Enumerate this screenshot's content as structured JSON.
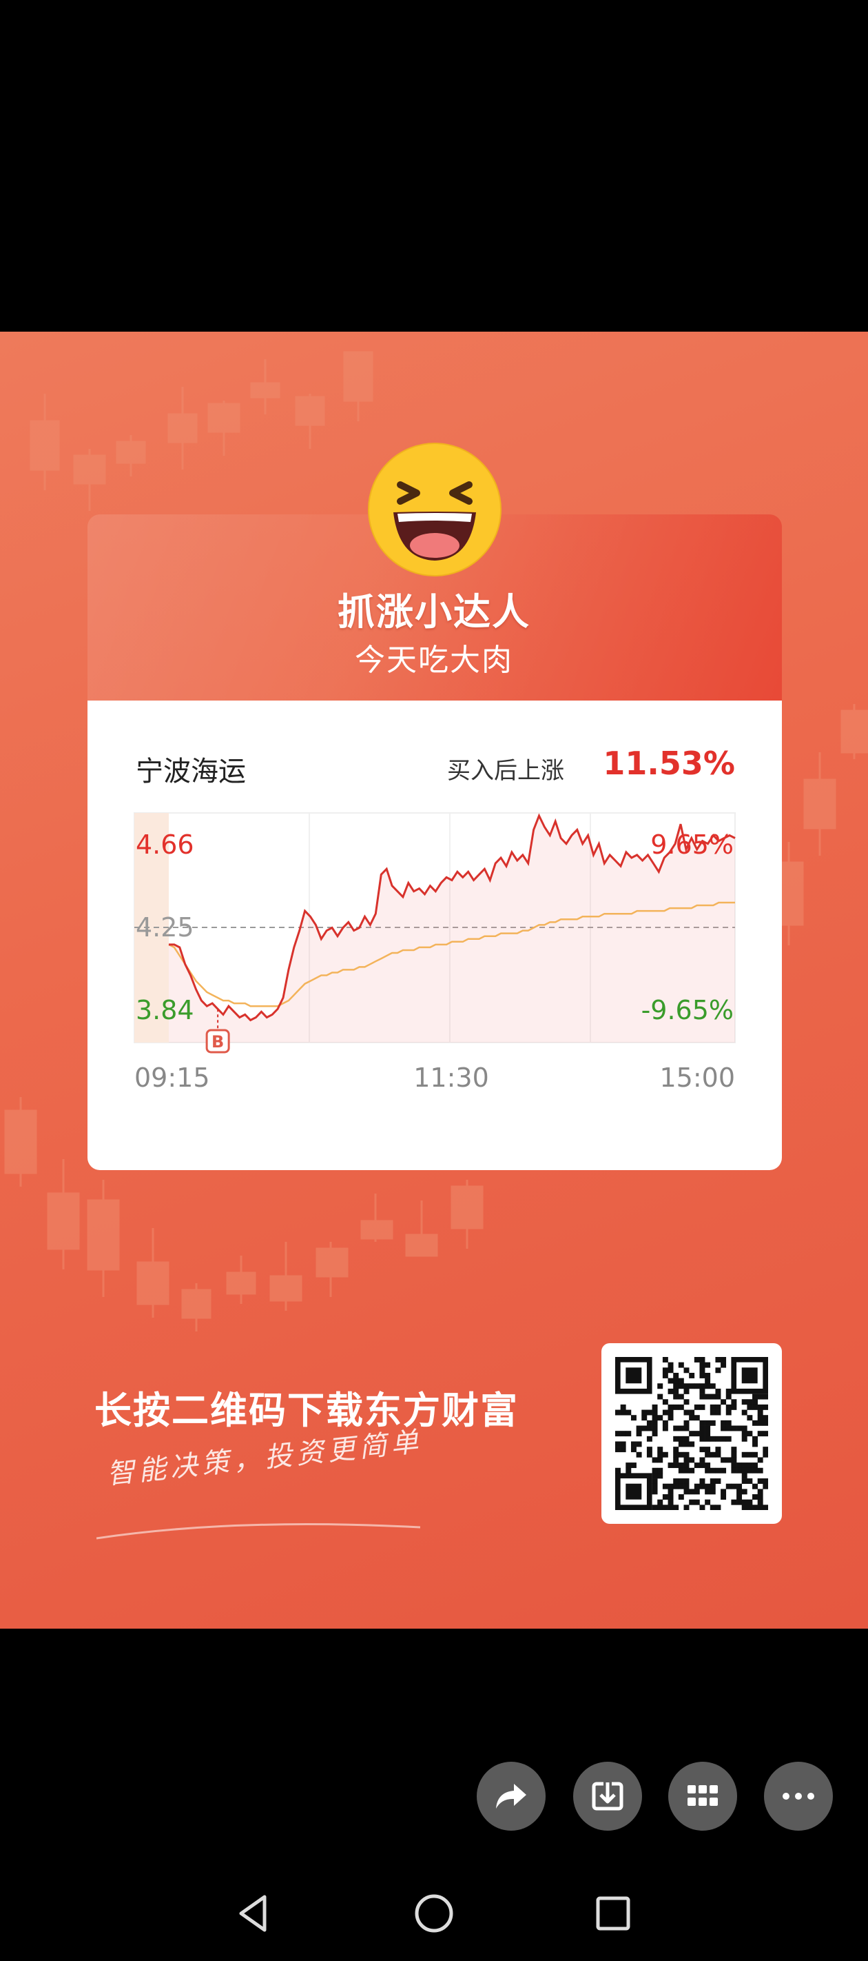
{
  "poster": {
    "headline": "抓涨小达人",
    "subheadline": "今天吃大肉",
    "cta": "长按二维码下载东方财富",
    "slogan": "智能决策，投资更简单"
  },
  "card": {
    "stock_name": "宁波海运",
    "gain_label": "买入后上涨",
    "gain_value": "11.53%"
  },
  "chart_data": {
    "type": "line",
    "y_labels": {
      "high": "4.66",
      "mid": "4.25",
      "low": "3.84"
    },
    "pct_labels": {
      "high": "9.65%",
      "low": "-9.65%"
    },
    "x_labels": [
      "09:15",
      "11:30",
      "15:00"
    ],
    "ylim": [
      3.84,
      4.66
    ],
    "reference_price": 4.25,
    "buy_marker": {
      "label": "B",
      "price": 3.96
    },
    "series": [
      {
        "values": [
          4.19,
          4.19,
          4.18,
          4.12,
          4.08,
          4.03,
          3.99,
          3.97,
          3.98,
          3.96,
          3.94,
          3.97,
          3.95,
          3.93,
          3.94,
          3.92,
          3.93,
          3.95,
          3.93,
          3.94,
          3.96,
          4.0,
          4.1,
          4.18,
          4.24,
          4.31,
          4.29,
          4.26,
          4.21,
          4.24,
          4.25,
          4.22,
          4.25,
          4.27,
          4.24,
          4.25,
          4.29,
          4.26,
          4.3,
          4.44,
          4.46,
          4.4,
          4.38,
          4.36,
          4.41,
          4.38,
          4.39,
          4.37,
          4.4,
          4.38,
          4.41,
          4.43,
          4.42,
          4.45,
          4.43,
          4.45,
          4.42,
          4.44,
          4.46,
          4.42,
          4.48,
          4.5,
          4.47,
          4.52,
          4.49,
          4.51,
          4.48,
          4.6,
          4.65,
          4.61,
          4.58,
          4.63,
          4.57,
          4.55,
          4.58,
          4.6,
          4.55,
          4.58,
          4.51,
          4.55,
          4.48,
          4.51,
          4.49,
          4.47,
          4.52,
          4.5,
          4.51,
          4.49,
          4.51,
          4.48,
          4.45,
          4.5,
          4.52,
          4.55,
          4.62,
          4.53,
          4.57,
          4.53,
          4.56,
          4.55,
          4.58,
          4.56,
          4.57,
          4.58,
          4.57
        ]
      },
      {
        "values": [
          4.19,
          4.18,
          4.15,
          4.12,
          4.09,
          4.06,
          4.04,
          4.02,
          4.01,
          4.0,
          3.99,
          3.99,
          3.98,
          3.98,
          3.98,
          3.97,
          3.97,
          3.97,
          3.97,
          3.97,
          3.97,
          3.98,
          3.99,
          4.01,
          4.03,
          4.05,
          4.06,
          4.07,
          4.08,
          4.08,
          4.09,
          4.09,
          4.1,
          4.1,
          4.1,
          4.11,
          4.11,
          4.12,
          4.13,
          4.14,
          4.15,
          4.16,
          4.16,
          4.17,
          4.17,
          4.17,
          4.18,
          4.18,
          4.18,
          4.19,
          4.19,
          4.19,
          4.2,
          4.2,
          4.2,
          4.21,
          4.21,
          4.21,
          4.22,
          4.22,
          4.22,
          4.23,
          4.23,
          4.23,
          4.23,
          4.24,
          4.24,
          4.25,
          4.26,
          4.26,
          4.27,
          4.27,
          4.28,
          4.28,
          4.28,
          4.28,
          4.29,
          4.29,
          4.29,
          4.29,
          4.3,
          4.3,
          4.3,
          4.3,
          4.3,
          4.3,
          4.31,
          4.31,
          4.31,
          4.31,
          4.31,
          4.31,
          4.32,
          4.32,
          4.32,
          4.32,
          4.32,
          4.33,
          4.33,
          4.33,
          4.33,
          4.34,
          4.34,
          4.34,
          4.34
        ]
      }
    ],
    "colors": {
      "price": "#d8322c",
      "avg": "#f3b35a",
      "up": "#e2312b",
      "down": "#3a9c2b"
    }
  }
}
